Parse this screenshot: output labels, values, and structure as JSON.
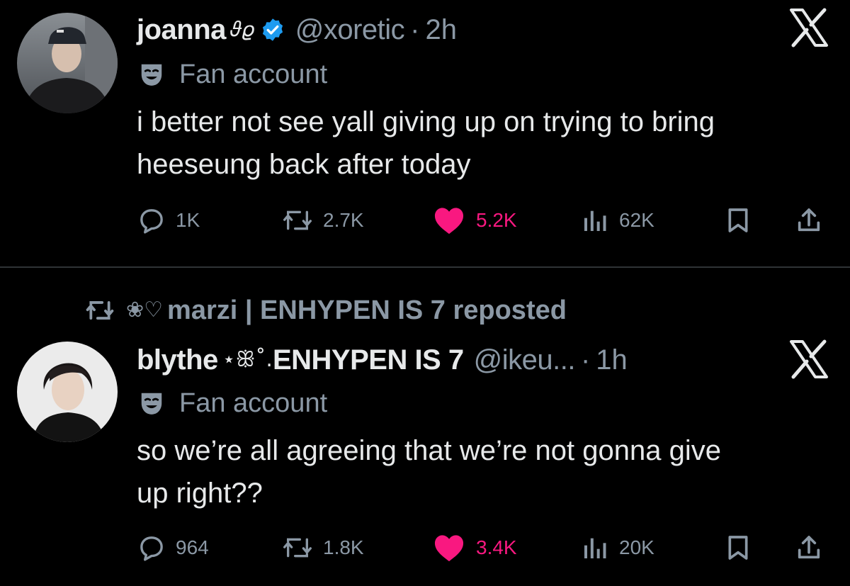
{
  "tweets": [
    {
      "display_name": "joanna",
      "name_deco": "𝜗𝜚",
      "verified": true,
      "handle": "@xoretic",
      "dot": "·",
      "time": "2h",
      "label": "Fan account",
      "text": "i better not see yall giving up on trying to bring\nheeseung back after today",
      "replies": "1K",
      "reposts": "2.7K",
      "likes": "5.2K",
      "views": "62K",
      "liked": true
    },
    {
      "repost_deco": "❀♡",
      "repost_text": "marzi | ENHYPEN IS 7 reposted",
      "display_name": "blythe",
      "name_deco": "⋆ꕥ˚. ",
      "display_name_suffix": "ENHYPEN IS 7",
      "handle": "@ikeu...",
      "dot": "·",
      "time": "1h",
      "label": "Fan account",
      "text": "so we’re all agreeing that we’re not gonna give\nup right??",
      "replies": "964",
      "reposts": "1.8K",
      "likes": "3.4K",
      "views": "20K",
      "liked": true
    }
  ],
  "icons": {
    "reply": "reply-icon",
    "repost": "repost-icon",
    "like": "heart-icon",
    "views": "views-icon",
    "bookmark": "bookmark-icon",
    "share": "share-icon",
    "close": "x-logo-icon",
    "verified": "verified-badge-icon",
    "label": "drama-mask-icon"
  },
  "colors": {
    "background": "#000000",
    "text": "#e7e9ea",
    "muted": "#8b98a5",
    "like": "#f91880",
    "verified": "#1d9bf0",
    "divider": "#2f3336"
  }
}
